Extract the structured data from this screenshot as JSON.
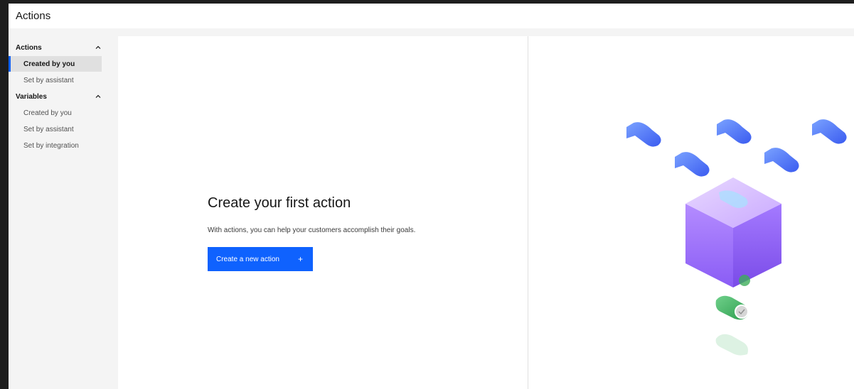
{
  "header": {
    "title": "Actions"
  },
  "sidebar": {
    "sections": [
      {
        "label": "Actions",
        "items": [
          {
            "label": "Created by you",
            "active": true
          },
          {
            "label": "Set by assistant",
            "active": false
          }
        ]
      },
      {
        "label": "Variables",
        "items": [
          {
            "label": "Created by you",
            "active": false
          },
          {
            "label": "Set by assistant",
            "active": false
          },
          {
            "label": "Set by integration",
            "active": false
          }
        ]
      }
    ]
  },
  "empty_state": {
    "title": "Create your first action",
    "description": "With actions, you can help your customers accomplish their goals.",
    "button_label": "Create a new action",
    "button_icon": "+"
  },
  "colors": {
    "accent": "#0f62fe",
    "bubble": "#4a6cf7",
    "cube": "#9b6bff",
    "check": "#3dae5a"
  },
  "icons": [
    "chevron-up-icon",
    "add-icon",
    "chat-bubble-icon",
    "checkmark-icon"
  ]
}
